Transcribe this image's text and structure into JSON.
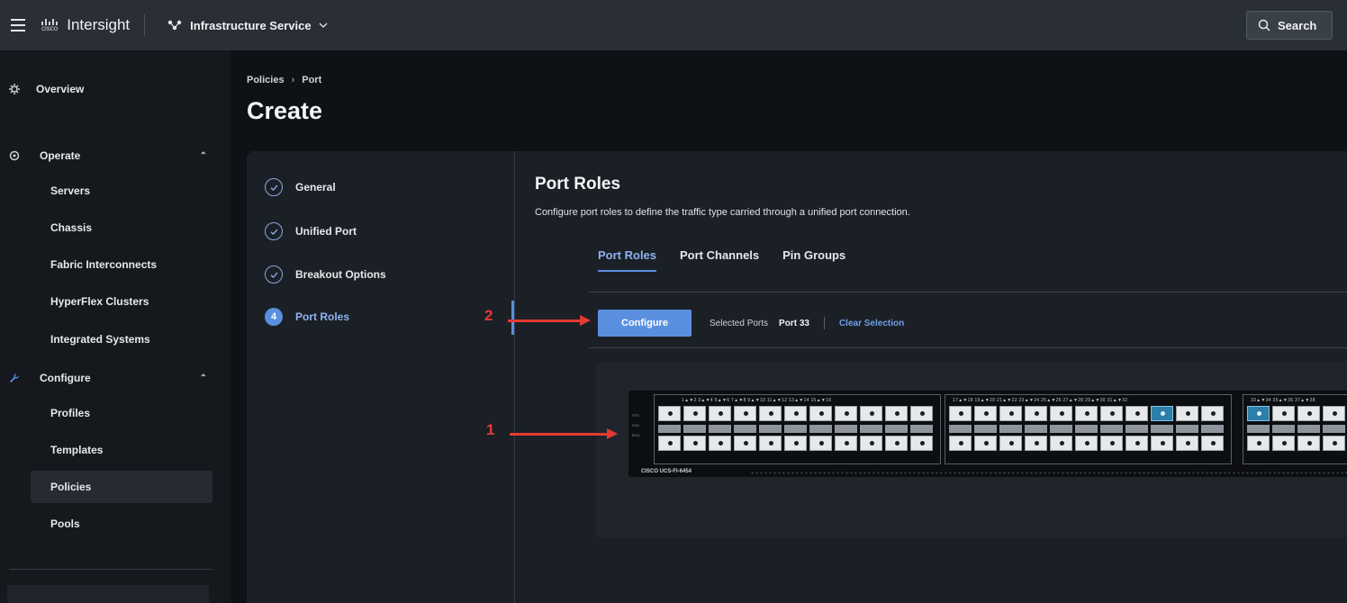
{
  "topbar": {
    "brand": "cisco",
    "app_name": "Intersight",
    "service": "Infrastructure Service",
    "search_label": "Search"
  },
  "sidebar": {
    "overview": "Overview",
    "operate": {
      "label": "Operate",
      "items": [
        "Servers",
        "Chassis",
        "Fabric Interconnects",
        "HyperFlex Clusters",
        "Integrated Systems"
      ]
    },
    "configure": {
      "label": "Configure",
      "items": [
        "Profiles",
        "Templates",
        "Policies",
        "Pools"
      ]
    },
    "active_item": "Policies"
  },
  "breadcrumb": {
    "root": "Policies",
    "current": "Port"
  },
  "page_title": "Create",
  "steps": [
    {
      "label": "General",
      "state": "done"
    },
    {
      "label": "Unified Port",
      "state": "done"
    },
    {
      "label": "Breakout Options",
      "state": "done"
    },
    {
      "label": "Port Roles",
      "state": "current",
      "number": "4"
    }
  ],
  "section": {
    "title": "Port Roles",
    "description": "Configure port roles to define the traffic type carried through a unified port connection."
  },
  "tabs": [
    "Port Roles",
    "Port Channels",
    "Pin Groups"
  ],
  "active_tab": "Port Roles",
  "toolbar": {
    "configure_label": "Configure",
    "selected_ports_label": "Selected Ports",
    "selected_ports_value": "Port 33",
    "clear_label": "Clear Selection"
  },
  "switch": {
    "model_label": "CISCO UCS-FI-6454",
    "group1_header": "1▲▼2   3▲▼4   5▲▼6   7▲▼8   9▲▼10  11▲▼12 13▲▼14 15▲▼16",
    "group2_header": "17▲▼18 19▲▼20 21▲▼22 23▲▼24 25▲▼26 27▲▼28 29▲▼30 31▲▼32",
    "group3_header": "33▲▼34 35▲▼36 37▲▼38",
    "selected_port": 33
  },
  "annotations": [
    "1",
    "2"
  ],
  "colors": {
    "accent": "#5a8fe0",
    "annotation": "#e53935",
    "selected_port": "#2c7fa8"
  }
}
